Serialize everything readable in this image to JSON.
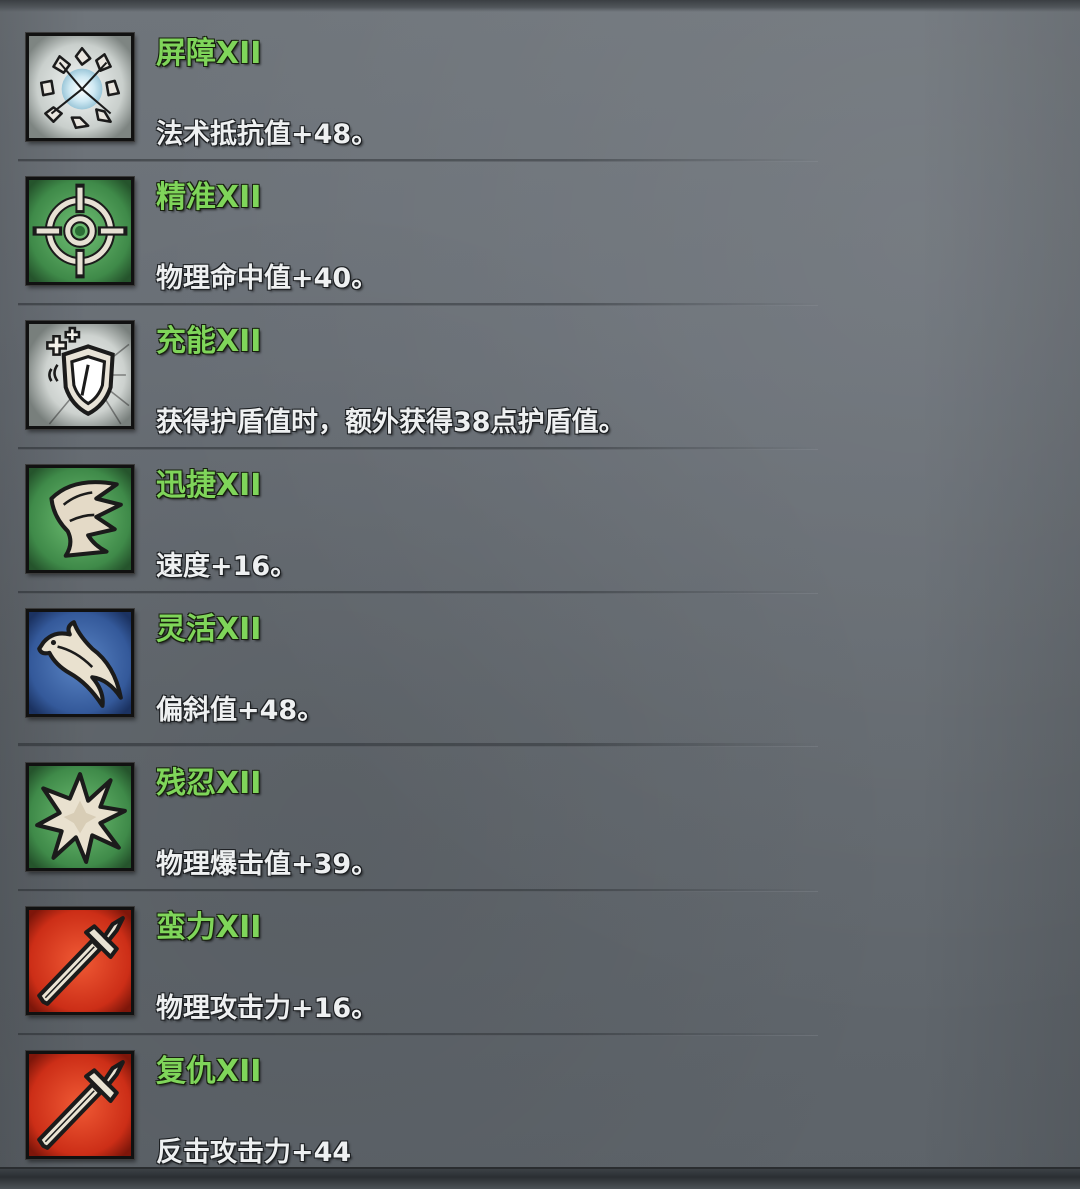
{
  "colors": {
    "title_green": "#7fd55a",
    "desc_white": "#eef0f1",
    "panel_gray": "#6a7077",
    "icon_green": "#4f9a55",
    "icon_white": "#e6ebe8",
    "icon_blue": "#3d67a8",
    "icon_red": "#d9351c"
  },
  "skills": [
    {
      "title": "屏障XII",
      "desc": "法术抵抗值+48。",
      "icon": "shatter-burst-icon",
      "icon_bg": "white"
    },
    {
      "title": "精准XII",
      "desc": "物理命中值+40。",
      "icon": "crosshair-target-icon",
      "icon_bg": "green"
    },
    {
      "title": "充能XII",
      "desc": "获得护盾值时，额外获得38点护盾值。",
      "icon": "shield-plus-icon",
      "icon_bg": "white"
    },
    {
      "title": "迅捷XII",
      "desc": "速度+16。",
      "icon": "swift-wing-icon",
      "icon_bg": "green"
    },
    {
      "title": "灵活XII",
      "desc": "偏斜值+48。",
      "icon": "agile-feather-icon",
      "icon_bg": "blue"
    },
    {
      "title": "残忍XII",
      "desc": "物理爆击值+39。",
      "icon": "starburst-icon",
      "icon_bg": "green"
    },
    {
      "title": "蛮力XII",
      "desc": "物理攻击力+16。",
      "icon": "sword-icon",
      "icon_bg": "red"
    },
    {
      "title": "复仇XII",
      "desc": "反击攻击力+44",
      "icon": "sword-icon",
      "icon_bg": "red"
    }
  ]
}
